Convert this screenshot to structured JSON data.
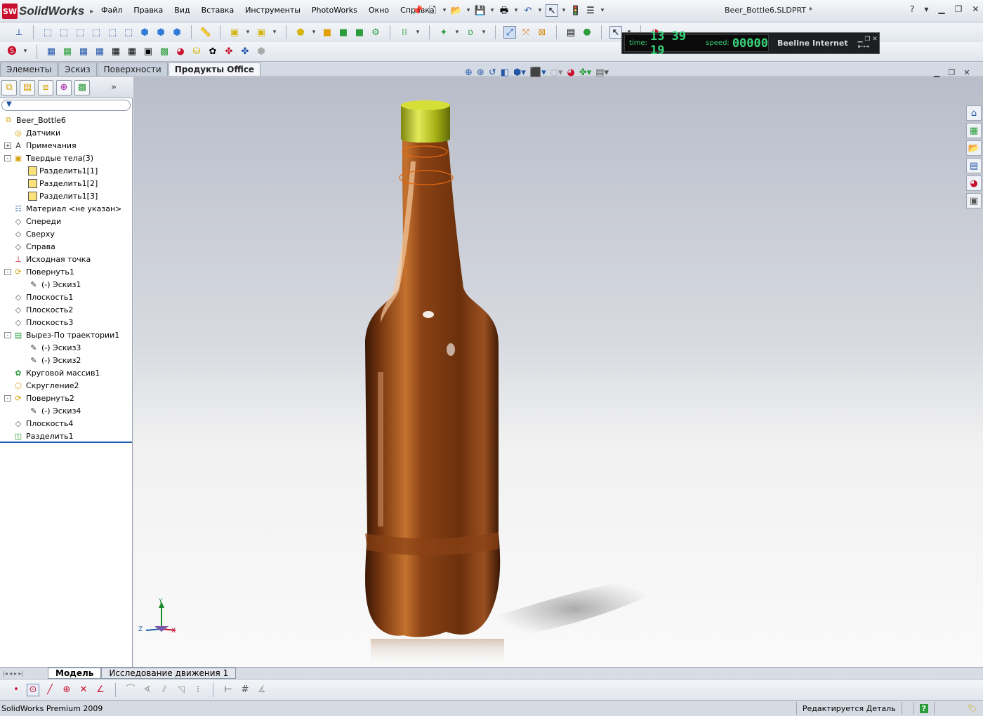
{
  "app": {
    "logo_badge": "SW",
    "logo_text": "SolidWorks",
    "menus": [
      "Файл",
      "Правка",
      "Вид",
      "Вставка",
      "Инструменты",
      "PhotoWorks",
      "Окно",
      "Справка"
    ],
    "document_title": "Beer_Bottle6.SLDPRT *",
    "help_glyph": "?"
  },
  "net_widget": {
    "time_label": "time:",
    "time_value": "13 39 19",
    "speed_label": "speed:",
    "speed_value": "00000",
    "name": "Beeline Internet"
  },
  "command_manager": {
    "tabs": [
      "Элементы",
      "Эскиз",
      "Поверхности",
      "Продукты Office"
    ],
    "active_tab": "Продукты Office"
  },
  "feature_tree": {
    "root": "Beer_Bottle6",
    "items": [
      {
        "label": "Датчики",
        "level": 1,
        "expand": "",
        "icon": "sensor-icon"
      },
      {
        "label": "Примечания",
        "level": 1,
        "expand": "+",
        "icon": "annotations-icon"
      },
      {
        "label": "Твердые тела(3)",
        "level": 1,
        "expand": "-",
        "icon": "solid-bodies-icon"
      },
      {
        "label": "Разделить1[1]",
        "level": 2,
        "expand": "",
        "icon": "body-icon"
      },
      {
        "label": "Разделить1[2]",
        "level": 2,
        "expand": "",
        "icon": "body-icon"
      },
      {
        "label": "Разделить1[3]",
        "level": 2,
        "expand": "",
        "icon": "body-icon"
      },
      {
        "label": "Материал <не указан>",
        "level": 1,
        "expand": "",
        "icon": "material-icon"
      },
      {
        "label": "Спереди",
        "level": 1,
        "expand": "",
        "icon": "plane-icon"
      },
      {
        "label": "Сверху",
        "level": 1,
        "expand": "",
        "icon": "plane-icon"
      },
      {
        "label": "Справа",
        "level": 1,
        "expand": "",
        "icon": "plane-icon"
      },
      {
        "label": "Исходная точка",
        "level": 1,
        "expand": "",
        "icon": "origin-icon"
      },
      {
        "label": "Повернуть1",
        "level": 1,
        "expand": "-",
        "icon": "revolve-icon"
      },
      {
        "label": "(-) Эскиз1",
        "level": 2,
        "expand": "",
        "icon": "sketch-icon"
      },
      {
        "label": "Плоскость1",
        "level": 1,
        "expand": "",
        "icon": "plane-icon"
      },
      {
        "label": "Плоскость2",
        "level": 1,
        "expand": "",
        "icon": "plane-icon"
      },
      {
        "label": "Плоскость3",
        "level": 1,
        "expand": "",
        "icon": "plane-icon"
      },
      {
        "label": "Вырез-По траектории1",
        "level": 1,
        "expand": "-",
        "icon": "sweep-cut-icon"
      },
      {
        "label": "(-) Эскиз3",
        "level": 2,
        "expand": "",
        "icon": "sketch-icon"
      },
      {
        "label": "(-) Эскиз2",
        "level": 2,
        "expand": "",
        "icon": "sketch-icon"
      },
      {
        "label": "Круговой массив1",
        "level": 1,
        "expand": "",
        "icon": "circular-pattern-icon"
      },
      {
        "label": "Скругление2",
        "level": 1,
        "expand": "",
        "icon": "fillet-icon"
      },
      {
        "label": "Повернуть2",
        "level": 1,
        "expand": "-",
        "icon": "revolve-icon"
      },
      {
        "label": "(-) Эскиз4",
        "level": 2,
        "expand": "",
        "icon": "sketch-icon"
      },
      {
        "label": "Плоскость4",
        "level": 1,
        "expand": "",
        "icon": "plane-icon"
      },
      {
        "label": "Разделить1",
        "level": 1,
        "expand": "",
        "icon": "split-icon"
      }
    ]
  },
  "triad": {
    "y": "Y",
    "z": "Z",
    "x": "X"
  },
  "bottom_tabs": [
    "Модель",
    "Исследование движения 1"
  ],
  "status": {
    "left": "SolidWorks Premium 2009",
    "mode": "Редактируется Деталь",
    "help": "?"
  },
  "colors": {
    "bottle": "#7a3b12",
    "cap": "#b9c21a",
    "accent": "#2456a8"
  }
}
